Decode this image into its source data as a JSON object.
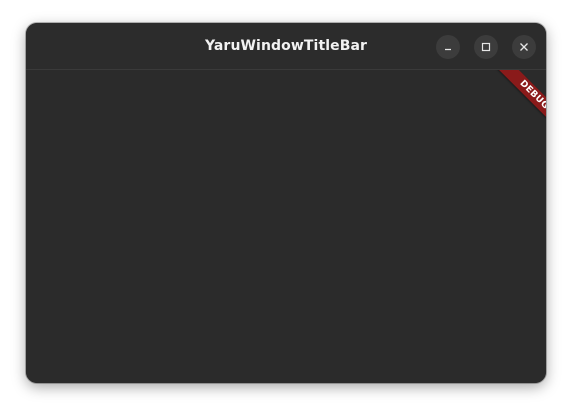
{
  "window": {
    "title": "YaruWindowTitleBar"
  },
  "controls": {
    "minimize_icon": "minimize-icon",
    "maximize_icon": "maximize-icon",
    "close_icon": "close-icon"
  },
  "banner": {
    "label": "DEBUG"
  },
  "colors": {
    "window_bg": "#2b2b2b",
    "control_bg": "#3c3c3c",
    "banner_bg": "#8a1a1a"
  }
}
